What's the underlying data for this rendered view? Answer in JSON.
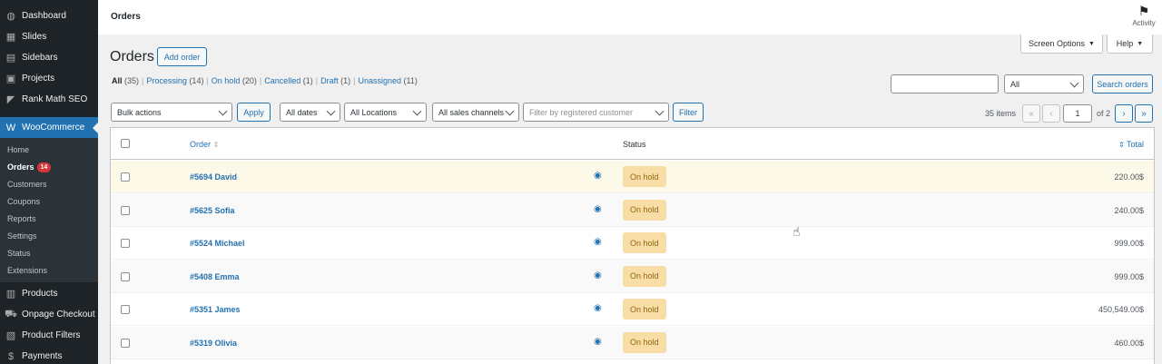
{
  "sidebar": {
    "top_items": [
      {
        "label": "Dashboard",
        "icon": "dashboard-icon",
        "glyph": "◍"
      },
      {
        "label": "Slides",
        "icon": "slides-icon",
        "glyph": "▦"
      },
      {
        "label": "Sidebars",
        "icon": "sidebars-icon",
        "glyph": "▤"
      },
      {
        "label": "Projects",
        "icon": "projects-icon",
        "glyph": "▣"
      },
      {
        "label": "Rank Math SEO",
        "icon": "rank-math-icon",
        "glyph": "◤"
      }
    ],
    "woocommerce": {
      "label": "WooCommerce",
      "icon": "woocommerce-icon",
      "glyph": "W"
    },
    "submenu": [
      {
        "label": "Home"
      },
      {
        "label": "Orders",
        "badge": "14"
      },
      {
        "label": "Customers"
      },
      {
        "label": "Coupons"
      },
      {
        "label": "Reports"
      },
      {
        "label": "Settings"
      },
      {
        "label": "Status"
      },
      {
        "label": "Extensions"
      }
    ],
    "bottom_items": [
      {
        "label": "Products",
        "icon": "products-icon",
        "glyph": "▥"
      },
      {
        "label": "Onpage Checkout",
        "icon": "cart-icon",
        "glyph": "⛟"
      },
      {
        "label": "Product Filters",
        "icon": "filter-icon",
        "glyph": "▧"
      },
      {
        "label": "Payments",
        "icon": "payments-icon",
        "glyph": "$"
      }
    ]
  },
  "header": {
    "title": "Orders",
    "activity": "Activity"
  },
  "screen_options": "Screen Options",
  "help": "Help",
  "page": {
    "heading": "Orders",
    "add_order": "Add order"
  },
  "views": [
    {
      "label": "All",
      "count": "(35)",
      "current": true
    },
    {
      "label": "Processing",
      "count": "(14)"
    },
    {
      "label": "On hold",
      "count": "(20)"
    },
    {
      "label": "Cancelled",
      "count": "(1)"
    },
    {
      "label": "Draft",
      "count": "(1)"
    },
    {
      "label": "Unassigned",
      "count": "(11)"
    }
  ],
  "search": {
    "value": "",
    "status_select": "All",
    "button": "Search orders"
  },
  "filters": {
    "bulk_actions": "Bulk actions",
    "apply": "Apply",
    "dates": "All dates",
    "locations": "All Locations",
    "channels": "All sales channels",
    "customer_placeholder": "Filter by registered customer",
    "filter": "Filter"
  },
  "pagination": {
    "items": "35 items",
    "first": "«",
    "prev": "‹",
    "current": "1",
    "of": "of 2",
    "next": "›",
    "last": "»"
  },
  "table": {
    "columns": {
      "order": "Order",
      "status": "Status",
      "total": "Total"
    },
    "rows": [
      {
        "order": "#5694 David",
        "status": "On hold",
        "total": "220.00$"
      },
      {
        "order": "#5625 Sofia",
        "status": "On hold",
        "total": "240.00$"
      },
      {
        "order": "#5524 Michael",
        "status": "On hold",
        "total": "999.00$"
      },
      {
        "order": "#5408 Emma",
        "status": "On hold",
        "total": "999.00$"
      },
      {
        "order": "#5351 James",
        "status": "On hold",
        "total": "450,549.00$"
      },
      {
        "order": "#5319 Olivia",
        "status": "On hold",
        "total": "460.00$"
      }
    ]
  },
  "colors": {
    "sidebar_bg": "#1d2327",
    "accent": "#2271b1",
    "on_hold_bg": "#f8dda7",
    "on_hold_text": "#94660c",
    "badge": "#d63638"
  }
}
